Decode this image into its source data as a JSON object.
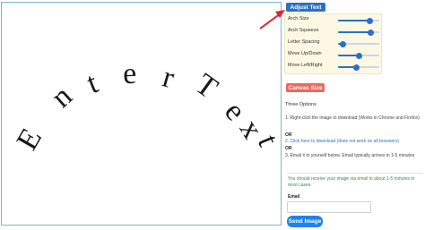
{
  "canvas": {
    "preview_text": "Enter Text",
    "letters": [
      "E",
      "n",
      "t",
      "e",
      "r",
      " ",
      "T",
      "e",
      "x",
      "t"
    ]
  },
  "controls": {
    "adjust_button": "Adjust Text",
    "sliders": [
      {
        "label": "Arch Size",
        "value": 0.78
      },
      {
        "label": "Arch Squeeze",
        "value": 0.8
      },
      {
        "label": "Letter Spacing",
        "value": 0.12
      },
      {
        "label": "Move Up/Down",
        "value": 0.5
      },
      {
        "label": "Move Left/Right",
        "value": 0.45
      }
    ],
    "canvas_size_button": "Canvas Size"
  },
  "options": {
    "title": "Three Options",
    "option1": "1. Right-click the image to download (Works in Chrome and Firefox)",
    "or1": "OR",
    "option2_link": "2. Click here to download (does not work on all browsers)",
    "or2": "OR",
    "option3": "3. Email it to yourself below. Email typically arrives in 1-5 minutes",
    "notice": "You should receive your image via email in about 1-5 minutes in most cases.",
    "email_label": "Email",
    "email_value": "",
    "email_placeholder": "",
    "send_button": "Send Image"
  },
  "colors": {
    "primary": "#2d6fc4",
    "canvas_button": "#e86a5c",
    "send_button": "#1f82f0",
    "arrow": "#e0222a",
    "notice": "#3a8a3a"
  },
  "icons": {
    "annotation": "red-arrow-icon"
  }
}
